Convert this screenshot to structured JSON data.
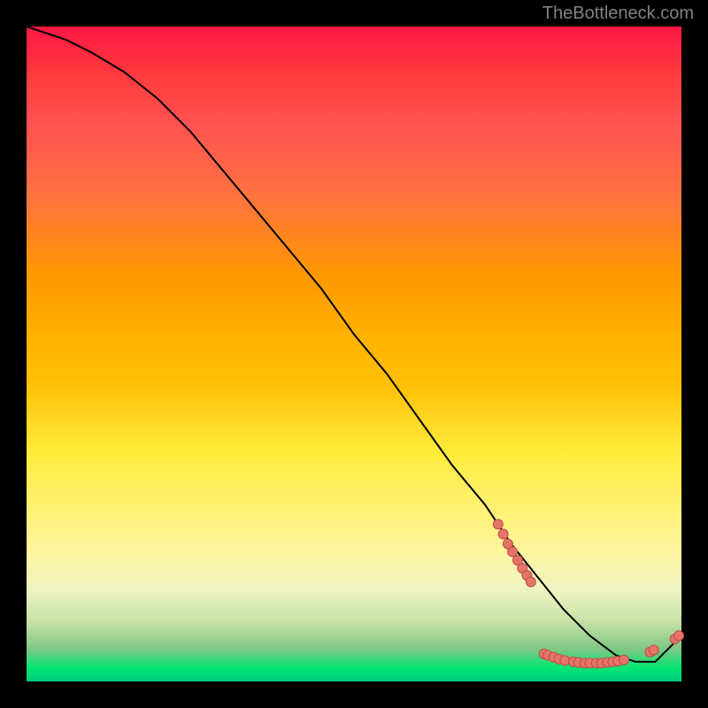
{
  "watermark": "TheBottleneck.com",
  "chart_data": {
    "type": "line",
    "title": "",
    "xlabel": "",
    "ylabel": "",
    "xlim": [
      0,
      100
    ],
    "ylim": [
      0,
      100
    ],
    "grid": false,
    "legend": false,
    "series": [
      {
        "name": "curve",
        "x": [
          0,
          3,
          6,
          10,
          15,
          20,
          25,
          30,
          35,
          40,
          45,
          50,
          55,
          60,
          65,
          70,
          74,
          78,
          82,
          86,
          90,
          93,
          96,
          98,
          100
        ],
        "y": [
          100,
          99,
          98,
          96,
          93,
          89,
          84,
          78,
          72,
          66,
          60,
          53,
          47,
          40,
          33,
          27,
          21,
          16,
          11,
          7,
          4,
          3,
          3,
          5,
          7
        ]
      }
    ],
    "markers": [
      {
        "x": 72.0,
        "y": 24.0
      },
      {
        "x": 72.8,
        "y": 22.5
      },
      {
        "x": 73.5,
        "y": 21.0
      },
      {
        "x": 74.2,
        "y": 19.8
      },
      {
        "x": 75.0,
        "y": 18.5
      },
      {
        "x": 75.7,
        "y": 17.3
      },
      {
        "x": 76.4,
        "y": 16.2
      },
      {
        "x": 77.0,
        "y": 15.2
      },
      {
        "x": 79.0,
        "y": 4.2
      },
      {
        "x": 79.6,
        "y": 4.0
      },
      {
        "x": 80.5,
        "y": 3.7
      },
      {
        "x": 81.3,
        "y": 3.4
      },
      {
        "x": 82.2,
        "y": 3.2
      },
      {
        "x": 83.5,
        "y": 3.0
      },
      {
        "x": 84.3,
        "y": 2.9
      },
      {
        "x": 85.2,
        "y": 2.8
      },
      {
        "x": 86.0,
        "y": 2.8
      },
      {
        "x": 87.0,
        "y": 2.8
      },
      {
        "x": 87.8,
        "y": 2.8
      },
      {
        "x": 88.7,
        "y": 2.9
      },
      {
        "x": 89.5,
        "y": 3.0
      },
      {
        "x": 90.3,
        "y": 3.1
      },
      {
        "x": 91.2,
        "y": 3.3
      },
      {
        "x": 95.2,
        "y": 4.5
      },
      {
        "x": 95.8,
        "y": 4.8
      },
      {
        "x": 99.0,
        "y": 6.5
      },
      {
        "x": 99.6,
        "y": 7.0
      }
    ],
    "colors": {
      "line": "#000000",
      "marker_fill": "#e57368",
      "marker_stroke": "#bb4f47"
    }
  }
}
